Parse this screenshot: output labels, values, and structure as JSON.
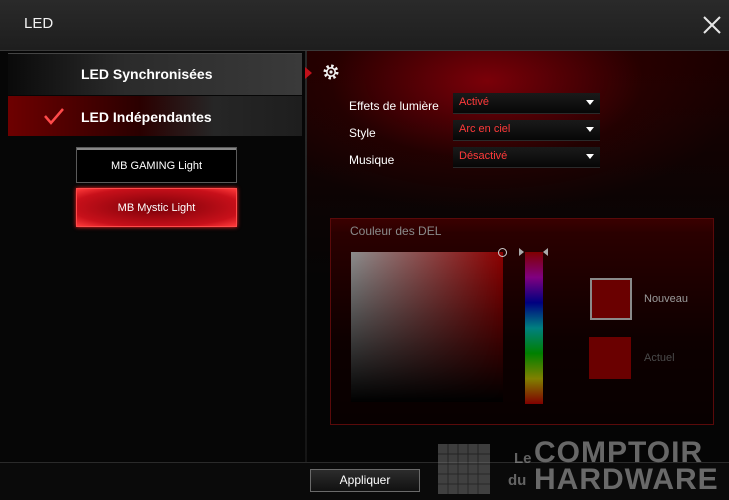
{
  "window": {
    "title": "LED",
    "close_icon": "close-icon"
  },
  "sidebar": {
    "items": [
      {
        "label": "LED Synchronisées",
        "selected": false
      },
      {
        "label": "LED Indépendantes",
        "selected": true,
        "icon": "check-icon"
      }
    ],
    "devices": [
      {
        "label": "MB GAMING Light",
        "selected": false
      },
      {
        "label": "MB Mystic Light",
        "selected": true
      }
    ]
  },
  "settings": {
    "icon": "gear-icon",
    "rows": [
      {
        "label": "Effets de lumière",
        "value": "Activé"
      },
      {
        "label": "Style",
        "value": "Arc en ciel"
      },
      {
        "label": "Musique",
        "value": "Désactivé"
      }
    ]
  },
  "color_panel": {
    "title": "Couleur des DEL",
    "new_label": "Nouveau",
    "current_label": "Actuel",
    "new_color": "#6a0000",
    "current_color": "#6a0000"
  },
  "footer": {
    "apply_label": "Appliquer"
  },
  "watermark": {
    "line_le": "Le",
    "line_comptoir": "COMPTOIR",
    "line_du": "du",
    "line_hardware": "HARDWARE"
  },
  "colors": {
    "accent": "#c8101a",
    "dropdown_value": "#ff3a3a"
  }
}
